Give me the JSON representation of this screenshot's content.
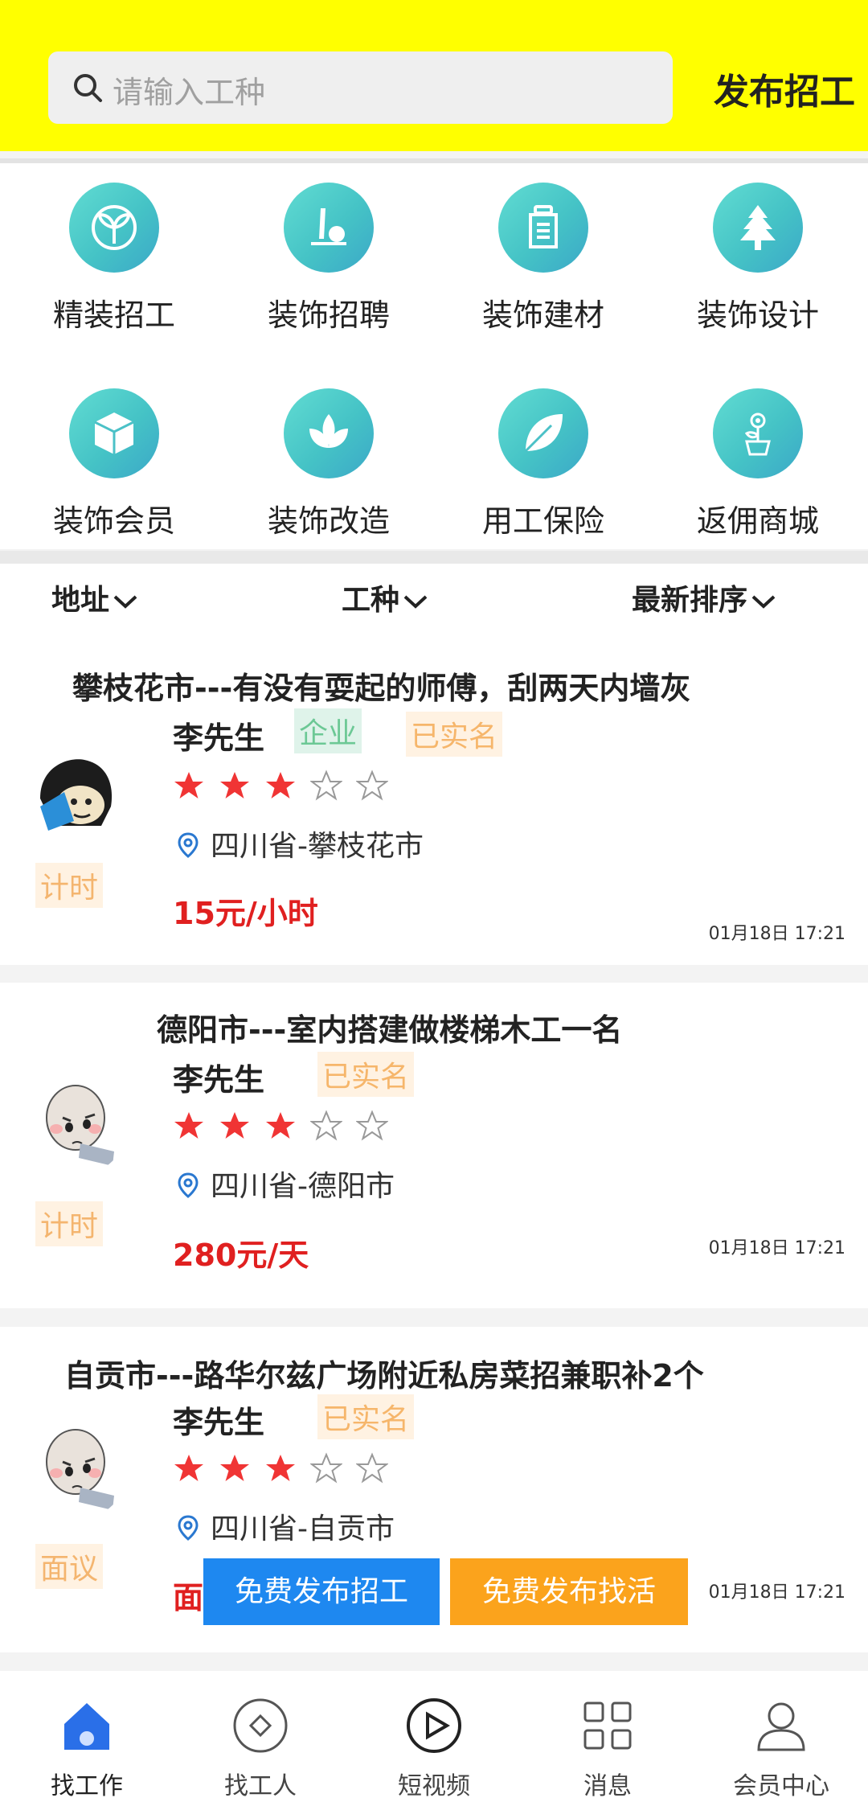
{
  "header": {
    "search_placeholder": "请输入工种",
    "publish_label": "发布招工"
  },
  "categories": [
    {
      "label": "精装招工",
      "icon": "sprout-icon"
    },
    {
      "label": "装饰招聘",
      "icon": "lamp-icon"
    },
    {
      "label": "装饰建材",
      "icon": "jar-icon"
    },
    {
      "label": "装饰设计",
      "icon": "tree-icon"
    },
    {
      "label": "装饰会员",
      "icon": "box-icon"
    },
    {
      "label": "装饰改造",
      "icon": "lotus-icon"
    },
    {
      "label": "用工保险",
      "icon": "leaf-icon"
    },
    {
      "label": "返佣商城",
      "icon": "flower-pot-icon"
    }
  ],
  "filters": {
    "address": "地址",
    "work_type": "工种",
    "sort": "最新排序"
  },
  "jobs": [
    {
      "title": "攀枝花市---有没有耍起的师傅，刮两天内墙灰",
      "name": "李先生",
      "tag_enterprise": "企业",
      "tag_verified": "已实名",
      "rating": 3,
      "location": "四川省-攀枝花市",
      "pay_type": "计时",
      "price": "15元/小时",
      "time": "01月18日 17:21"
    },
    {
      "title": "德阳市---室内搭建做楼梯木工一名",
      "name": "李先生",
      "tag_verified": "已实名",
      "rating": 3,
      "location": "四川省-德阳市",
      "pay_type": "计时",
      "price": "280元/天",
      "time": "01月18日 17:21"
    },
    {
      "title": "自贡市---路华尔兹广场附近私房菜招兼职补2个",
      "name": "李先生",
      "tag_verified": "已实名",
      "rating": 3,
      "location": "四川省-自贡市",
      "pay_type": "面议",
      "price": "面",
      "time": "01月18日 17:21"
    }
  ],
  "float_buttons": {
    "post_job": "免费发布招工",
    "find_work": "免费发布找活"
  },
  "tabbar": [
    {
      "label": "找工作",
      "icon": "home-icon",
      "active": true
    },
    {
      "label": "找工人",
      "icon": "diamond-circle-icon"
    },
    {
      "label": "短视频",
      "icon": "play-circle-icon"
    },
    {
      "label": "消息",
      "icon": "grid-icon"
    },
    {
      "label": "会员中心",
      "icon": "user-icon"
    }
  ],
  "colors": {
    "header_bg": "#ffff00",
    "accent_teal": "#45c3c6",
    "price_red": "#e02020",
    "star_red": "#f03434",
    "btn_blue": "#1e88f0",
    "btn_orange": "#fba31c"
  }
}
